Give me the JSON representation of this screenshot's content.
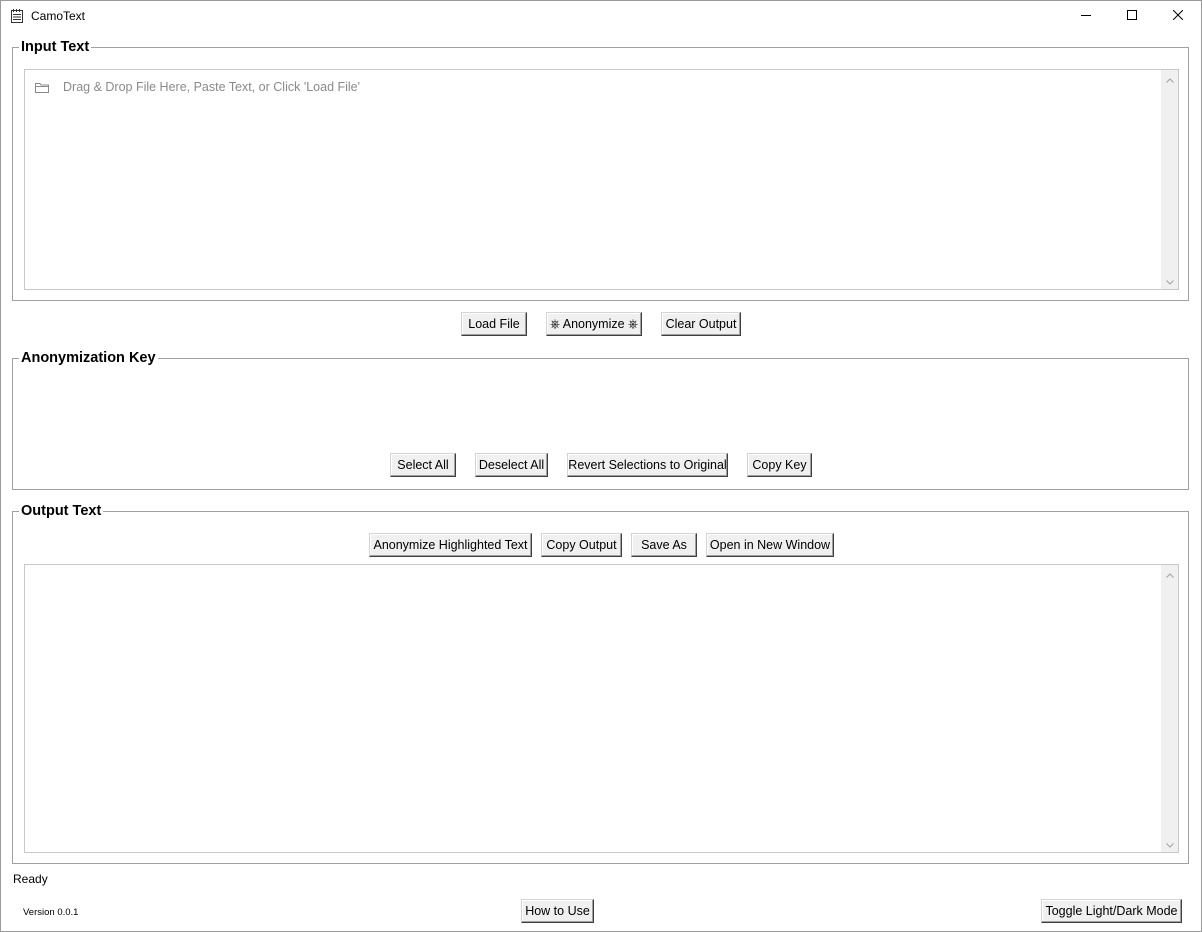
{
  "window": {
    "title": "CamoText",
    "controls": {
      "minimize": "minimize-icon",
      "maximize": "maximize-icon",
      "close": "close-icon"
    }
  },
  "input_section": {
    "title": "Input Text",
    "placeholder": "Drag & Drop File Here, Paste Text, or Click 'Load File'",
    "placeholder_icon": "folder-icon"
  },
  "main_actions": {
    "load_file": "Load File",
    "anonymize": "⎈ Anonymize ⎈",
    "clear_output": "Clear Output"
  },
  "key_section": {
    "title": "Anonymization Key",
    "select_all": "Select All",
    "deselect_all": "Deselect All",
    "revert": "Revert Selections to Original",
    "copy_key": "Copy Key"
  },
  "output_section": {
    "title": "Output Text",
    "anonymize_highlighted": "Anonymize Highlighted Text",
    "copy_output": "Copy Output",
    "save_as": "Save As",
    "open_new_window": "Open in New Window",
    "content": ""
  },
  "footer": {
    "status": "Ready",
    "version": "Version 0.0.1",
    "how_to_use": "How to Use",
    "toggle_mode": "Toggle Light/Dark Mode"
  }
}
